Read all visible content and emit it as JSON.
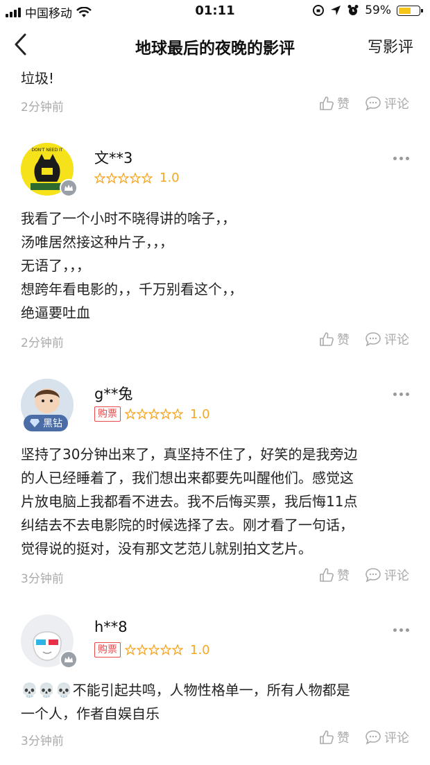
{
  "status_bar": {
    "carrier": "中国移动",
    "time": "01:11",
    "battery": "59%",
    "battery_level": 0.59
  },
  "nav": {
    "title": "地球最后的夜晚的影评",
    "write_review": "写影评"
  },
  "top_partial": {
    "text": "垃圾!",
    "time": "2分钟前",
    "like": "赞",
    "comment": "评论"
  },
  "reviews": [
    {
      "username": "文**3",
      "ticket_tag": "",
      "score": "1.0",
      "stars_filled": 0,
      "lines": [
        "我看了一个小时不晓得讲的啥子，，",
        "汤唯居然接这种片子，，，",
        "无语了，，，",
        "想跨年看电影的，，千万别看这个，，",
        "绝逼要吐血"
      ],
      "time": "2分钟前",
      "like": "赞",
      "comment": "评论"
    },
    {
      "username": "g**兔",
      "ticket_tag": "购票",
      "badge_text": "黑钻",
      "score": "1.0",
      "stars_filled": 0,
      "lines": [
        "坚持了30分钟出来了，真坚持不住了，好笑的是我旁边",
        "的人已经睡着了，我们想出来都要先叫醒他们。感觉这",
        "片放电脑上我都看不进去。我不后悔买票，我后悔11点",
        "纠结去不去电影院的时候选择了去。刚才看了一句话，",
        "觉得说的挺对，没有那文艺范儿就别拍文艺片。"
      ],
      "time": "3分钟前",
      "like": "赞",
      "comment": "评论"
    },
    {
      "username": "h**8",
      "ticket_tag": "购票",
      "score": "1.0",
      "stars_filled": 0,
      "lines": [
        "💀💀💀不能引起共鸣，人物性格单一，所有人物都是",
        "一个人，作者自娱自乐"
      ],
      "time": "3分钟前",
      "like": "赞",
      "comment": "评论"
    }
  ],
  "colors": {
    "accent_star": "#f5a623",
    "ticket_red": "#e8494a",
    "muted": "#aaaaaa"
  }
}
